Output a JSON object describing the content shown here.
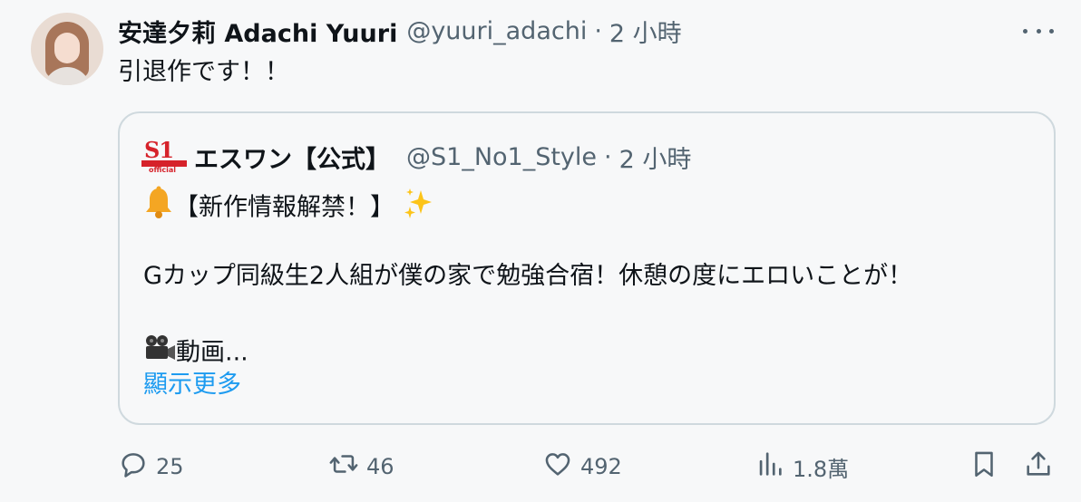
{
  "author": {
    "display_name": "安達夕莉 Adachi Yuuri",
    "handle": "@yuuri_adachi",
    "separator": "·",
    "time": "2 小時"
  },
  "tweet_text": "引退作です！！",
  "quote": {
    "display_name": "エスワン【公式】",
    "handle": "@S1_No1_Style",
    "separator": "·",
    "time": "2 小時",
    "line1": "【新作情報解禁！】",
    "line2": "Gカップ同級生2人組が僕の家で勉強合宿！休憩の度にエロいことが！",
    "line3": "動画...",
    "show_more": "顯示更多",
    "logo_text": "S1",
    "logo_sub": "official"
  },
  "actions": {
    "replies": "25",
    "retweets": "46",
    "likes": "492",
    "views": "1.8萬"
  },
  "colors": {
    "accent": "#1d9bf0",
    "muted": "#536471",
    "text": "#0f1419",
    "border": "#cfd9de",
    "brand_red": "#d6222a"
  },
  "icons": [
    "more-icon",
    "bell-emoji",
    "sparkles-emoji",
    "movie-camera-emoji",
    "reply-icon",
    "retweet-icon",
    "like-icon",
    "views-icon",
    "bookmark-icon",
    "share-icon"
  ]
}
